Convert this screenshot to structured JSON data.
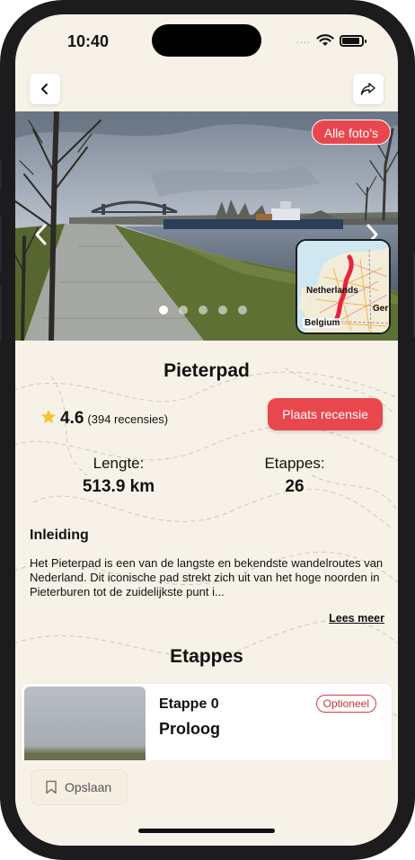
{
  "status_bar": {
    "time": "10:40",
    "signal_dots": "...."
  },
  "trail": {
    "name": "Pieterpad",
    "rating": "4.6",
    "reviews": "(394 recensies)",
    "review_button": "Plaats recensie",
    "length_label": "Lengte:",
    "length_value": "513.9 km",
    "stages_label": "Etappes:",
    "stages_value": "26"
  },
  "hero": {
    "all_photos_button": "Alle foto's",
    "photo_count": 5,
    "active_photo": 1,
    "map_labels": {
      "netherlands": "Netherlands",
      "belgium": "Belgium",
      "germany": "Ger"
    }
  },
  "intro": {
    "heading": "Inleiding",
    "text": "Het Pieterpad is een van de langste en bekendste wandelroutes van Nederland. Dit iconische pad strekt zich uit van het hoge noorden in Pieterburen tot de zuidelijkste punt i...",
    "read_more": "Lees meer"
  },
  "stages_section": {
    "heading": "Etappes",
    "items": [
      {
        "number": "Etappe 0",
        "name": "Proloog",
        "badge": "Optioneel"
      }
    ]
  },
  "bottom_bar": {
    "save_label": "Opslaan"
  },
  "colors": {
    "accent": "#e8474d",
    "background": "#f7f2e8"
  },
  "icons": [
    "back-icon",
    "share-icon",
    "chevron-left-icon",
    "chevron-right-icon",
    "star-icon",
    "bookmark-icon"
  ]
}
